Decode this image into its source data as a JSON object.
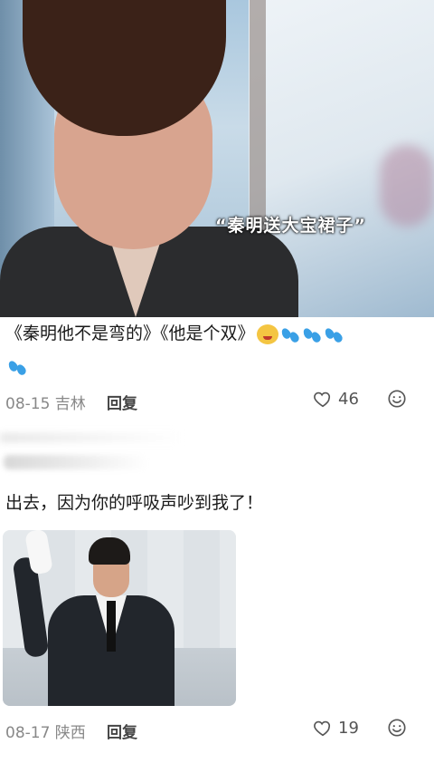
{
  "comment1": {
    "subtitle": "“秦明送大宝裙子”",
    "text": "《秦明他不是弯的》《他是个双》",
    "date_location": "08-15 吉林",
    "reply_label": "回复",
    "like_count": "46"
  },
  "comment2": {
    "text": "出去，因为你的呼吸声吵到我了！",
    "date_location": "08-17 陕西",
    "reply_label": "回复",
    "like_count": "19"
  },
  "icons": [
    "heart-outline-icon",
    "emoji-icon",
    "sweat-drops-icon",
    "laughing-face-icon"
  ]
}
